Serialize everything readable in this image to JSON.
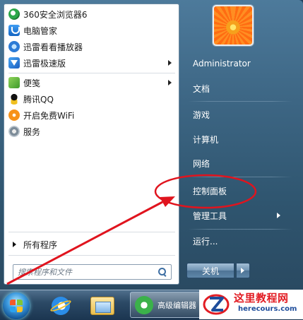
{
  "start_menu": {
    "programs": [
      {
        "label": "360安全浏览器6",
        "icon": "360-browser-icon",
        "submenu": false
      },
      {
        "label": "电脑管家",
        "icon": "pc-manager-icon",
        "submenu": false
      },
      {
        "label": "迅雷看看播放器",
        "icon": "xunlei-kankan-icon",
        "submenu": false
      },
      {
        "label": "迅雷极速版",
        "icon": "xunlei-icon",
        "submenu": true
      },
      {
        "label": "便笺",
        "icon": "sticky-notes-icon",
        "submenu": true
      },
      {
        "label": "腾讯QQ",
        "icon": "qq-icon",
        "submenu": false
      },
      {
        "label": "开启免费WiFi",
        "icon": "wifi-icon",
        "submenu": false
      },
      {
        "label": "服务",
        "icon": "services-icon",
        "submenu": false
      }
    ],
    "all_programs_label": "所有程序",
    "search_placeholder": "搜索程序和文件",
    "right_links": [
      {
        "label": "Administrator",
        "submenu": false
      },
      {
        "label": "文档",
        "submenu": false
      },
      {
        "label": "游戏",
        "submenu": false
      },
      {
        "label": "计算机",
        "submenu": false
      },
      {
        "label": "网络",
        "submenu": false
      },
      {
        "label": "控制面板",
        "submenu": false
      },
      {
        "label": "管理工具",
        "submenu": true
      },
      {
        "label": "运行...",
        "submenu": false
      }
    ],
    "shutdown_label": "关机"
  },
  "taskbar": {
    "items": [
      {
        "icon": "start-orb-icon"
      },
      {
        "icon": "internet-explorer-icon"
      },
      {
        "icon": "file-explorer-icon"
      },
      {
        "icon": "advanced-editor-icon",
        "label": "高级编辑器"
      }
    ]
  },
  "watermark": {
    "title": "这里教程网",
    "url": "herecours.com"
  },
  "annotation": {
    "highlight": "控制面板",
    "color": "#e0141e"
  }
}
